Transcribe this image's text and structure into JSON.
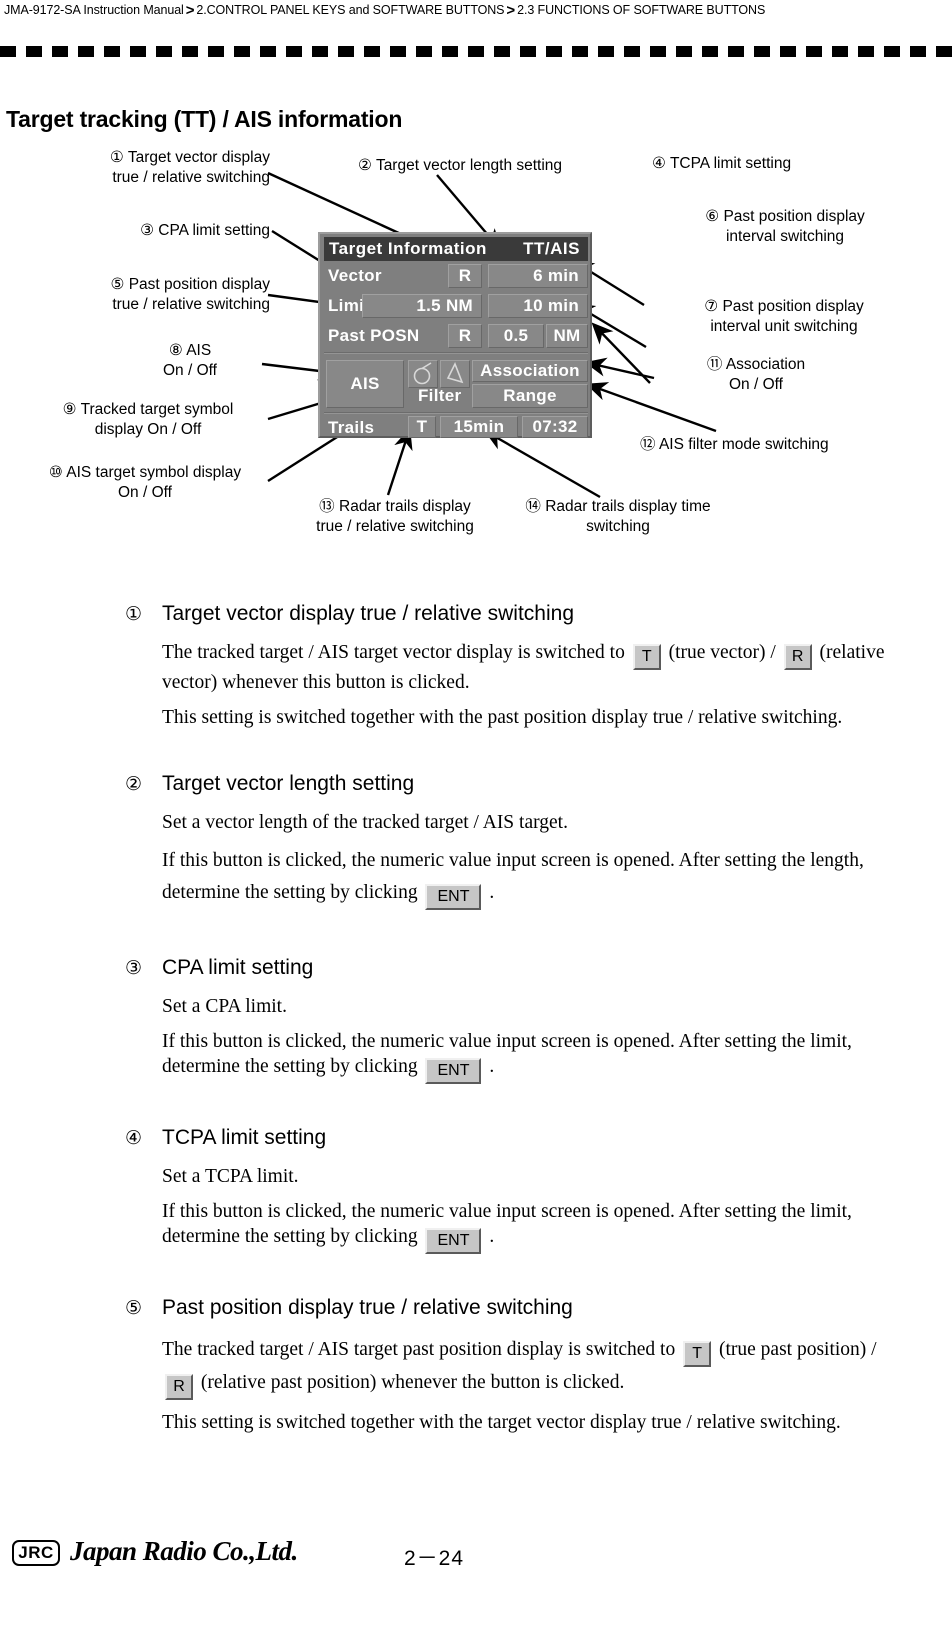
{
  "header": {
    "breadcrumb_parts": [
      "JMA-9172-SA Instruction Manual",
      "2.CONTROL PANEL KEYS and SOFTWARE BUTTONS",
      "2.3  FUNCTIONS OF SOFTWARE BUTTONS"
    ],
    "separator": ">"
  },
  "section": {
    "title": "Target tracking (TT) / AIS information"
  },
  "figure": {
    "panel": {
      "title_left": "Target  Information",
      "title_right": "TT/AIS",
      "rows": {
        "vector_label": "Vector",
        "vector_mode": "R",
        "vector_length": "6 min",
        "limit_label": "Limit",
        "limit_cpa": "1.5 NM",
        "limit_tcpa": "10 min",
        "past_label": "Past  POSN",
        "past_mode": "R",
        "past_interval": "0.5",
        "past_unit": "NM",
        "ais_label": "AIS",
        "symbol_tt": "tracked-target-symbol",
        "symbol_ais": "ais-target-symbol",
        "association_label": "Association",
        "filter_label": "Filter",
        "filter_mode": "Range",
        "trails_label": "Trails",
        "trails_mode": "T",
        "trails_time": "15min",
        "trails_clock": "07:32"
      }
    },
    "callouts": [
      {
        "num": "①",
        "text": "Target vector display\ntrue / relative switching"
      },
      {
        "num": "②",
        "text": "Target vector length setting"
      },
      {
        "num": "③",
        "text": "CPA limit setting"
      },
      {
        "num": "④",
        "text": "TCPA limit setting"
      },
      {
        "num": "⑤",
        "text": "Past position display\ntrue / relative switching"
      },
      {
        "num": "⑥",
        "text": "Past position display\ninterval switching"
      },
      {
        "num": "⑦",
        "text": "Past position display\ninterval unit switching"
      },
      {
        "num": "⑧",
        "text": "AIS\nOn / Off"
      },
      {
        "num": "⑨",
        "text": "Tracked target symbol\ndisplay On / Off"
      },
      {
        "num": "⑩",
        "text": "AIS target symbol display\nOn / Off"
      },
      {
        "num": "⑪",
        "text": "Association\nOn / Off"
      },
      {
        "num": "⑫",
        "text": "AIS filter mode switching"
      },
      {
        "num": "⑬",
        "text": "Radar trails display\ntrue / relative switching"
      },
      {
        "num": "⑭",
        "text": "Radar trails display time\nswitching"
      }
    ]
  },
  "items": [
    {
      "num": "①",
      "title": "Target vector display true / relative switching",
      "p1_a": "The tracked target / AIS target vector display is switched to",
      "p1_key1": "T",
      "p1_b": "(true vector) /",
      "p1_key2": "R",
      "p1_c": "(relative vector) whenever this button is clicked.",
      "p2": "This setting is switched together with the past position display true / relative switching."
    },
    {
      "num": "②",
      "title": "Target vector length setting",
      "p1": "Set a vector length of the tracked target / AIS target.",
      "p2_a": "If this button is clicked, the numeric value input screen is opened. After setting the length, determine the setting by clicking",
      "p2_key": "ENT",
      "p2_b": "."
    },
    {
      "num": "③",
      "title": "CPA limit setting",
      "p1": "Set a CPA limit.",
      "p2_a": "If this button is clicked, the numeric value input screen is opened. After setting the limit, determine the setting by clicking",
      "p2_key": "ENT",
      "p2_b": "."
    },
    {
      "num": "④",
      "title": "TCPA limit setting",
      "p1": "Set a TCPA limit.",
      "p2_a": "If this button is clicked, the numeric value input screen is opened. After setting the limit, determine the setting by clicking",
      "p2_key": "ENT",
      "p2_b": "."
    },
    {
      "num": "⑤",
      "title": "Past position display true / relative switching",
      "p1_a": "The tracked target / AIS target past position display is switched to",
      "p1_key1": "T",
      "p1_b": "(true past position) /",
      "p1_key2": "R",
      "p1_c": "(relative past position) whenever the button is clicked.",
      "p2": "This setting is switched together with the target vector display true / relative switching."
    }
  ],
  "footer": {
    "logo_badge": "JRC",
    "company": "Japan Radio Co.,Ltd.",
    "page_number": "2－24"
  }
}
